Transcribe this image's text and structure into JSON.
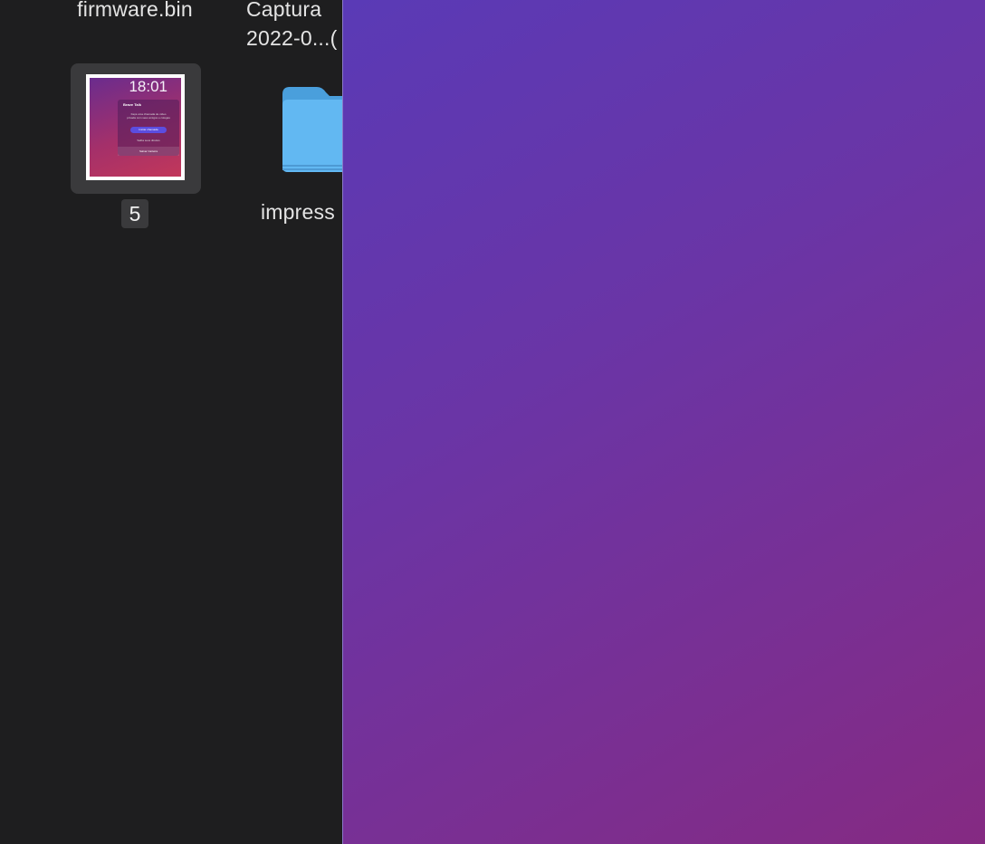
{
  "finder": {
    "items": [
      {
        "name": "firmware.bin"
      },
      {
        "name_line1": "Captura",
        "name_line2": "2022-0...("
      },
      {
        "label": "5",
        "thumbnail": {
          "clock": "18:01",
          "card_title": "Brave Talk",
          "card_text": "Faça uma chamada de vídeo privada com seus amigos e colegas",
          "card_button": "Iniciar chamada",
          "card_link": "Saiba seus direitos",
          "card_bottom": "Salvar Carteira"
        }
      },
      {
        "name": "impress",
        "icon": "folder-icon"
      }
    ]
  },
  "colors": {
    "finder_bg": "#1e1e1f",
    "selection_bg": "#3a3a3c",
    "folder_blue": "#5fb6f0",
    "desktop_gradient_start": "#5a3ab6",
    "desktop_gradient_end": "#852a82"
  }
}
